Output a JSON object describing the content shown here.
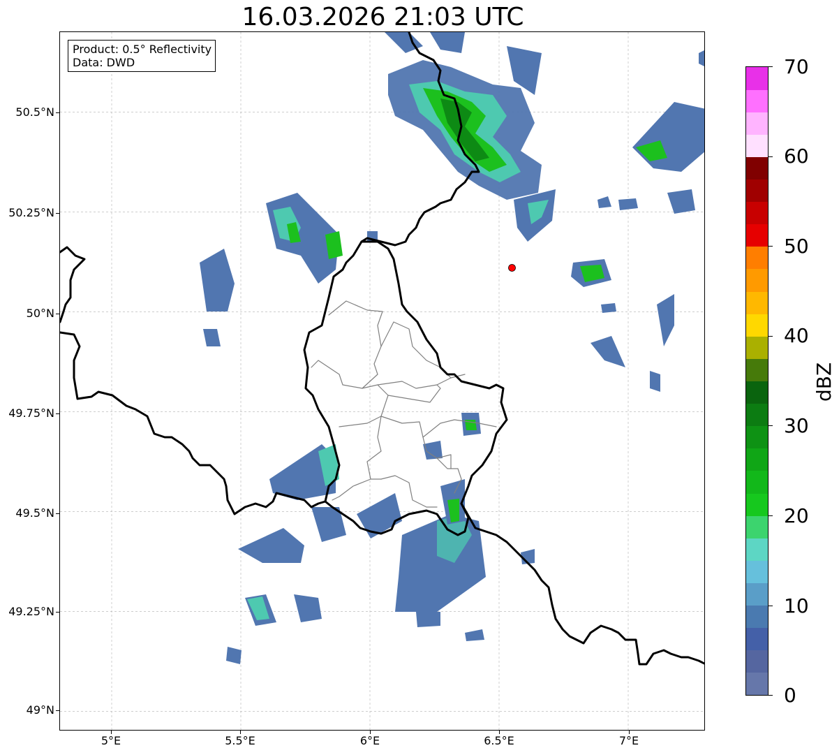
{
  "title": "16.03.2026 21:03 UTC",
  "info_box": {
    "product": "Product: 0.5° Reflectivity",
    "source": "Data: DWD"
  },
  "axes": {
    "lon_ticks": [
      "5°E",
      "5.5°E",
      "6°E",
      "6.5°E",
      "7°E"
    ],
    "lat_ticks": [
      "50.5°N",
      "50.25°N",
      "50°N",
      "49.75°N",
      "49.5°N",
      "49.25°N",
      "49°N"
    ],
    "lon_range": [
      4.8,
      7.3
    ],
    "lat_range": [
      48.95,
      50.7
    ],
    "grid": true
  },
  "colorbar": {
    "label": "dBZ",
    "tick_labels": [
      "0",
      "10",
      "20",
      "30",
      "40",
      "50",
      "60",
      "70"
    ],
    "min": 0,
    "max": 70,
    "colors": [
      "#6677aa",
      "#5566a0",
      "#4460a8",
      "#4a7ab0",
      "#5a9ec8",
      "#66c0dc",
      "#5dd6c4",
      "#3cd46e",
      "#16c81e",
      "#12b81a",
      "#10a616",
      "#0e9214",
      "#0c7c12",
      "#0a640e",
      "#467a0a",
      "#aab000",
      "#ffd800",
      "#ffb800",
      "#ff9a00",
      "#ff7e00",
      "#e60000",
      "#c80000",
      "#a00000",
      "#800000",
      "#ffe0ff",
      "#ffb4ff",
      "#ff70ff",
      "#e830e8"
    ]
  },
  "site_marker_color": "#ff0000",
  "chart_data": {
    "type": "heatmap",
    "title": "16.03.2026 21:03 UTC",
    "xlabel": "",
    "ylabel": "",
    "xlim": [
      4.8,
      7.3
    ],
    "ylim": [
      48.95,
      50.7
    ],
    "unit": "dBZ",
    "scale": [
      0,
      70
    ],
    "site": {
      "lon": 6.55,
      "lat": 50.11
    },
    "echoes": [
      {
        "lon": 6.35,
        "lat": 50.47,
        "dbz": 30
      },
      {
        "lon": 6.42,
        "lat": 50.38,
        "dbz": 28
      },
      {
        "lon": 6.22,
        "lat": 50.58,
        "dbz": 25
      },
      {
        "lon": 7.12,
        "lat": 50.4,
        "dbz": 22
      },
      {
        "lon": 6.86,
        "lat": 50.1,
        "dbz": 25
      },
      {
        "lon": 6.68,
        "lat": 50.25,
        "dbz": 15
      },
      {
        "lon": 5.46,
        "lat": 50.07,
        "dbz": 5
      },
      {
        "lon": 5.6,
        "lat": 50.23,
        "dbz": 15
      },
      {
        "lon": 5.7,
        "lat": 49.57,
        "dbz": 10
      },
      {
        "lon": 5.6,
        "lat": 49.42,
        "dbz": 10
      },
      {
        "lon": 6.3,
        "lat": 49.35,
        "dbz": 8
      },
      {
        "lon": 6.35,
        "lat": 49.52,
        "dbz": 20
      },
      {
        "lon": 6.38,
        "lat": 49.73,
        "dbz": 22
      },
      {
        "lon": 5.58,
        "lat": 49.26,
        "dbz": 15
      },
      {
        "lon": 5.72,
        "lat": 49.27,
        "dbz": 10
      }
    ]
  }
}
